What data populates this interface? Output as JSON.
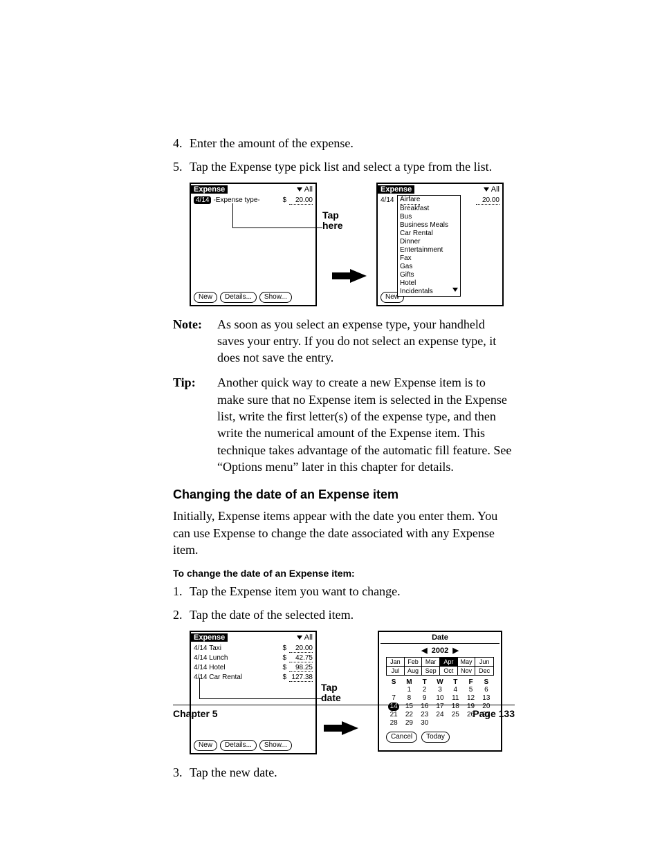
{
  "steps_a": [
    {
      "num": "4.",
      "text": "Enter the amount of the expense."
    },
    {
      "num": "5.",
      "text": "Tap the Expense type pick list and select a type from the list."
    }
  ],
  "screen1": {
    "title": "Expense",
    "filter": "All",
    "date": "4/14",
    "placeholder": "-Expense type-",
    "currency": "$",
    "amount": "20.00",
    "buttons": [
      "New",
      "Details...",
      "Show..."
    ]
  },
  "callout1": "Tap\nhere",
  "screen2": {
    "title": "Expense",
    "filter": "All",
    "date": "4/14",
    "amount": "20.00",
    "types": [
      "Airfare",
      "Breakfast",
      "Bus",
      "Business Meals",
      "Car Rental",
      "Dinner",
      "Entertainment",
      "Fax",
      "Gas",
      "Gifts",
      "Hotel",
      "Incidentals"
    ],
    "new": "New"
  },
  "note": {
    "label": "Note:",
    "text": "As soon as you select an expense type, your handheld saves your entry. If you do not select an expense type, it does not save the entry."
  },
  "tip": {
    "label": "Tip:",
    "text": "Another quick way to create a new Expense item is to make sure that no Expense item is selected in the Expense list, write the first letter(s) of the expense type, and then write the numerical amount of the Expense item. This technique takes advantage of the automatic fill feature. See “Options menu” later in this chapter for details."
  },
  "h3": "Changing the date of an Expense item",
  "para": "Initially, Expense items appear with the date you enter them. You can use Expense to change the date associated with any Expense item.",
  "h4": "To change the date of an Expense item:",
  "steps_b": [
    {
      "num": "1.",
      "text": "Tap the Expense item you want to change."
    },
    {
      "num": "2.",
      "text": "Tap the date of the selected item."
    }
  ],
  "screen3": {
    "title": "Expense",
    "filter": "All",
    "rows": [
      {
        "date": "4/14",
        "name": "Taxi",
        "amount": "20.00"
      },
      {
        "date": "4/14",
        "name": "Lunch",
        "amount": "42.75"
      },
      {
        "date": "4/14",
        "name": "Hotel",
        "amount": "98.25"
      },
      {
        "date": "4/14",
        "name": "Car Rental",
        "amount": "127.38"
      }
    ],
    "buttons": [
      "New",
      "Details...",
      "Show..."
    ]
  },
  "callout2": "Tap\ndate",
  "date_screen": {
    "title": "Date",
    "year": "2002",
    "months1": [
      "Jan",
      "Feb",
      "Mar",
      "Apr",
      "May",
      "Jun"
    ],
    "months2": [
      "Jul",
      "Aug",
      "Sep",
      "Oct",
      "Nov",
      "Dec"
    ],
    "selected_month": "Apr",
    "dow": [
      "S",
      "M",
      "T",
      "W",
      "T",
      "F",
      "S"
    ],
    "weeks": [
      [
        "",
        "1",
        "2",
        "3",
        "4",
        "5",
        "6"
      ],
      [
        "7",
        "8",
        "9",
        "10",
        "11",
        "12",
        "13"
      ],
      [
        "14",
        "15",
        "16",
        "17",
        "18",
        "19",
        "20"
      ],
      [
        "21",
        "22",
        "23",
        "24",
        "25",
        "26",
        "27"
      ],
      [
        "28",
        "29",
        "30",
        "",
        "",
        "",
        ""
      ]
    ],
    "selected_day": "14",
    "cancel": "Cancel",
    "today": "Today"
  },
  "step_c": {
    "num": "3.",
    "text": "Tap the new date."
  },
  "footer": {
    "left": "Chapter 5",
    "right": "Page 133"
  }
}
